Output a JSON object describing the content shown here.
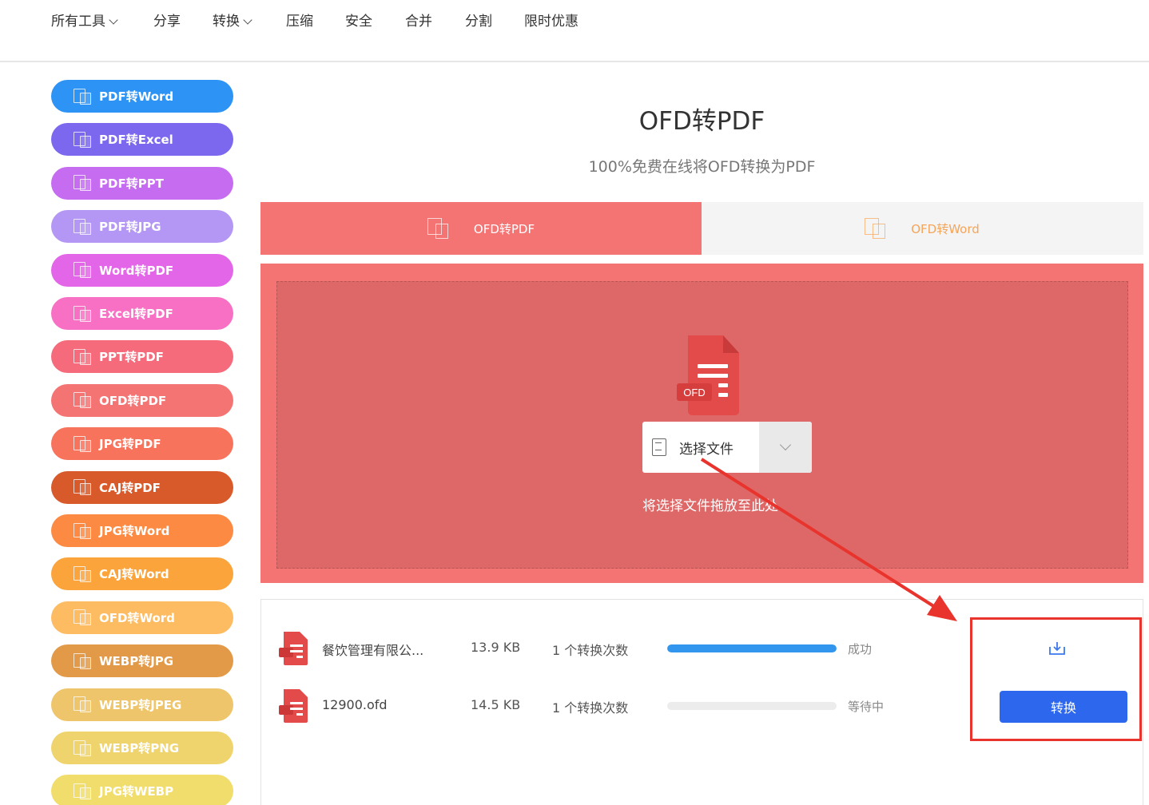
{
  "nav": {
    "items": [
      {
        "label": "所有工具",
        "dropdown": true
      },
      {
        "label": "分享",
        "dropdown": false
      },
      {
        "label": "转换",
        "dropdown": true
      },
      {
        "label": "压缩",
        "dropdown": false
      },
      {
        "label": "安全",
        "dropdown": false
      },
      {
        "label": "合并",
        "dropdown": false
      },
      {
        "label": "分割",
        "dropdown": false
      },
      {
        "label": "限时优惠",
        "dropdown": false
      }
    ]
  },
  "sidebar": {
    "items": [
      {
        "label": "PDF转Word",
        "color": "#2d93f4"
      },
      {
        "label": "PDF转Excel",
        "color": "#7b68ee"
      },
      {
        "label": "PDF转PPT",
        "color": "#c56cf0"
      },
      {
        "label": "PDF转JPG",
        "color": "#b497f4"
      },
      {
        "label": "Word转PDF",
        "color": "#e466e8"
      },
      {
        "label": "Excel转PDF",
        "color": "#f870c4"
      },
      {
        "label": "PPT转PDF",
        "color": "#f56b7c"
      },
      {
        "label": "OFD转PDF",
        "color": "#f47474"
      },
      {
        "label": "JPG转PDF",
        "color": "#f8735c"
      },
      {
        "label": "CAJ转PDF",
        "color": "#d85a2a"
      },
      {
        "label": "JPG转Word",
        "color": "#fc8a42"
      },
      {
        "label": "CAJ转Word",
        "color": "#fba43c"
      },
      {
        "label": "OFD转Word",
        "color": "#fdbb62"
      },
      {
        "label": "WEBP转JPG",
        "color": "#e29a48"
      },
      {
        "label": "WEBP转JPEG",
        "color": "#eec56a"
      },
      {
        "label": "WEBP转PNG",
        "color": "#efd36c"
      },
      {
        "label": "JPG转WEBP",
        "color": "#f1dd6c"
      }
    ]
  },
  "main": {
    "title": "OFD转PDF",
    "subtitle": "100%免费在线将OFD转换为PDF",
    "tabs": [
      {
        "label": "OFD转PDF",
        "active": true
      },
      {
        "label": "OFD转Word",
        "active": false
      }
    ],
    "upload": {
      "file_badge": "OFD",
      "choose_label": "选择文件",
      "hint": "将选择文件拖放至此处"
    },
    "files": [
      {
        "name": "餐饮管理有限公...",
        "size": "13.9 KB",
        "count": "1 个转换次数",
        "progress": 1.0,
        "status": "成功"
      },
      {
        "name": "12900.ofd",
        "size": "14.5 KB",
        "count": "1 个转换次数",
        "progress": 0.0,
        "status": "等待中"
      }
    ],
    "convert_label": "转换"
  },
  "colors": {
    "accent_red": "#f47474",
    "progress_blue": "#3296ef",
    "button_blue": "#2c67ee",
    "annotation_red": "#e8342c"
  }
}
